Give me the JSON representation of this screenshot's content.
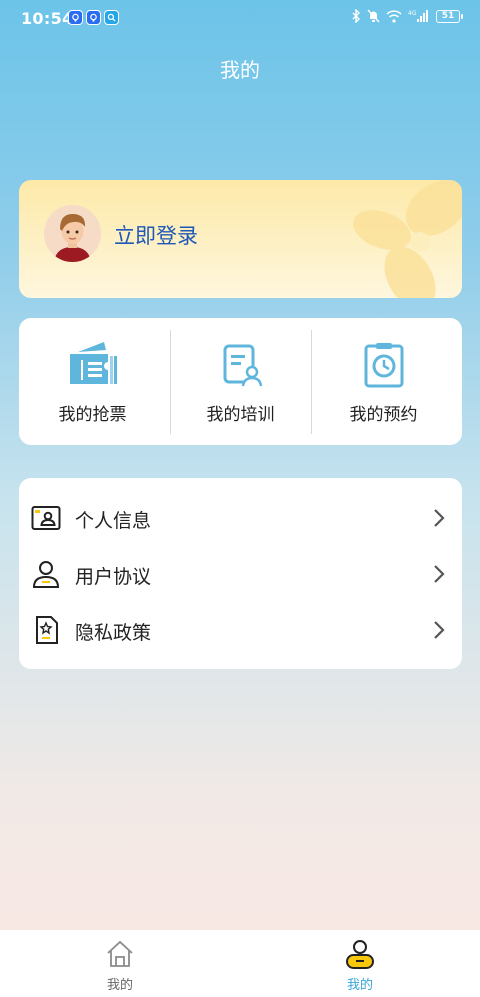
{
  "status_bar": {
    "time": "10:54",
    "battery": "51"
  },
  "header": {
    "title": "我的"
  },
  "login": {
    "label": "立即登录"
  },
  "quick_actions": [
    {
      "label": "我的抢票",
      "icon": "ticket-icon"
    },
    {
      "label": "我的培训",
      "icon": "training-doc-icon"
    },
    {
      "label": "我的预约",
      "icon": "clock-clipboard-icon"
    }
  ],
  "menu": [
    {
      "label": "个人信息",
      "icon": "id-card-icon"
    },
    {
      "label": "用户协议",
      "icon": "user-icon"
    },
    {
      "label": "隐私政策",
      "icon": "privacy-doc-icon"
    }
  ],
  "tab_bar": {
    "tabs": [
      {
        "label": "我的",
        "icon": "home-icon",
        "active": false
      },
      {
        "label": "我的",
        "icon": "profile-icon",
        "active": true
      }
    ]
  },
  "colors": {
    "accent_blue": "#5fb6dd",
    "login_text": "#1f58b7",
    "icon_yellow": "#f7c80d"
  }
}
